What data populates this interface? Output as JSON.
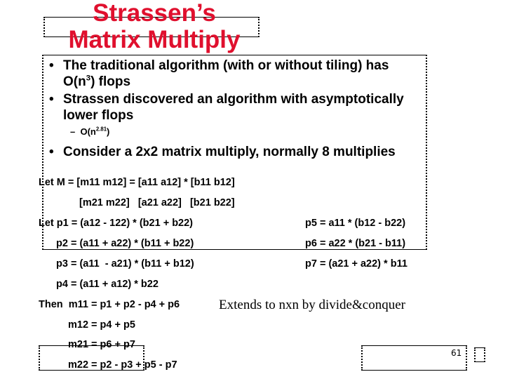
{
  "slide": {
    "title_line1": "Strassen’s",
    "title_line2": "Matrix Multiply",
    "title_color": "#e0102e",
    "bullets": [
      {
        "pre": "The traditional algorithm (with or without tiling) has",
        "line2_pre": "O(n",
        "line2_sup": "3",
        "line2_post": ") flops"
      },
      {
        "line1": "Strassen discovered an algorithm with asymptotically",
        "line2": "lower flops"
      },
      {
        "line1": "Consider a 2x2 matrix multiply, normally 8 multiplies"
      }
    ],
    "sub_bullet": {
      "dash": "–",
      "pre": "O(n",
      "sup": "2.81",
      "post": ")"
    },
    "bullet_glyph": "•",
    "equations": {
      "let_m": "Let M = [m11 m12] = [a11 a12] * [b11 b12]",
      "matrix_row2": "[m21 m22]   [a21 a22]   [b21 b22]",
      "p1": "Let p1 = (a12 - 122) * (b21 + b22)",
      "p2": "p2 = (a11 + a22) * (b11 + b22)",
      "p3": "p3 = (a11  - a21) * (b11 + b12)",
      "p4": "p4 = (a11 + a12) * b22",
      "p5": "p5 = a11 * (b12 - b22)",
      "p6": "p6 = a22 * (b21 - b11)",
      "p7": "p7 = (a21 + a22) * b11",
      "m11": "Then  m11 = p1 + p2 - p4 + p6",
      "m12": "m12 = p4 + p5",
      "m21": "m21 = p6 + p7",
      "m22": "m22 = p2 - p3 + p5 - p7"
    },
    "note": "Extends to nxn by divide&conquer",
    "page_number": "61"
  }
}
